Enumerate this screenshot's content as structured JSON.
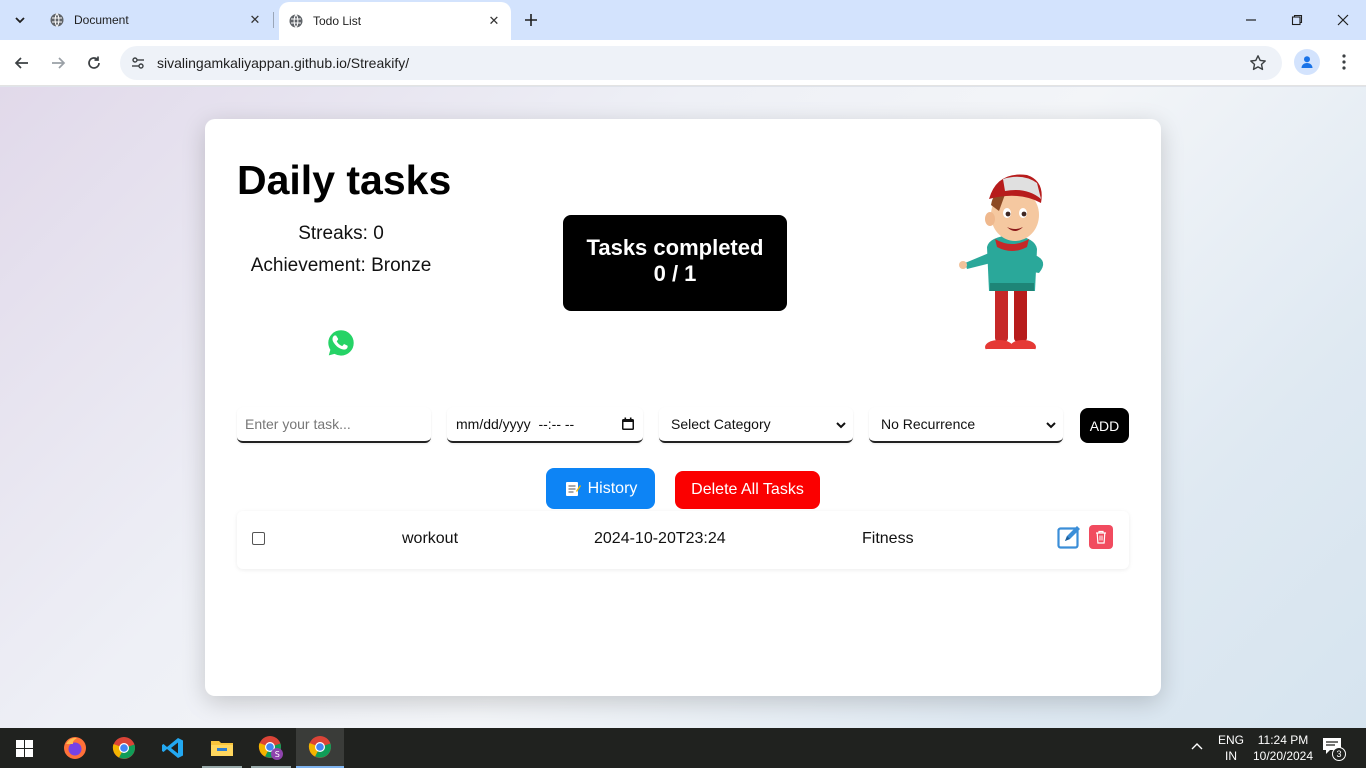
{
  "browser": {
    "tabs": [
      {
        "title": "Document",
        "active": false
      },
      {
        "title": "Todo List",
        "active": true
      }
    ],
    "url": "sivalingamkaliyappan.github.io/Streakify/"
  },
  "app": {
    "title": "Daily tasks",
    "streaks": "Streaks: 0",
    "achievement": "Achievement: Bronze",
    "progress_title": "Tasks completed",
    "progress_count": "0 / 1",
    "form": {
      "task_placeholder": "Enter your task...",
      "date_value": "mm/dd/yyyy  --:-- --",
      "category_selected": "Select Category",
      "recurrence_selected": "No Recurrence",
      "add_label": "ADD"
    },
    "history_label": "History",
    "delete_all_label": "Delete All Tasks",
    "tasks": [
      {
        "name": "workout",
        "due": "2024-10-20T23:24",
        "category": "Fitness",
        "done": false
      }
    ]
  },
  "taskbar": {
    "language": "ENG",
    "region": "IN",
    "time": "11:24 PM",
    "date": "10/20/2024",
    "notification_count": "3"
  }
}
